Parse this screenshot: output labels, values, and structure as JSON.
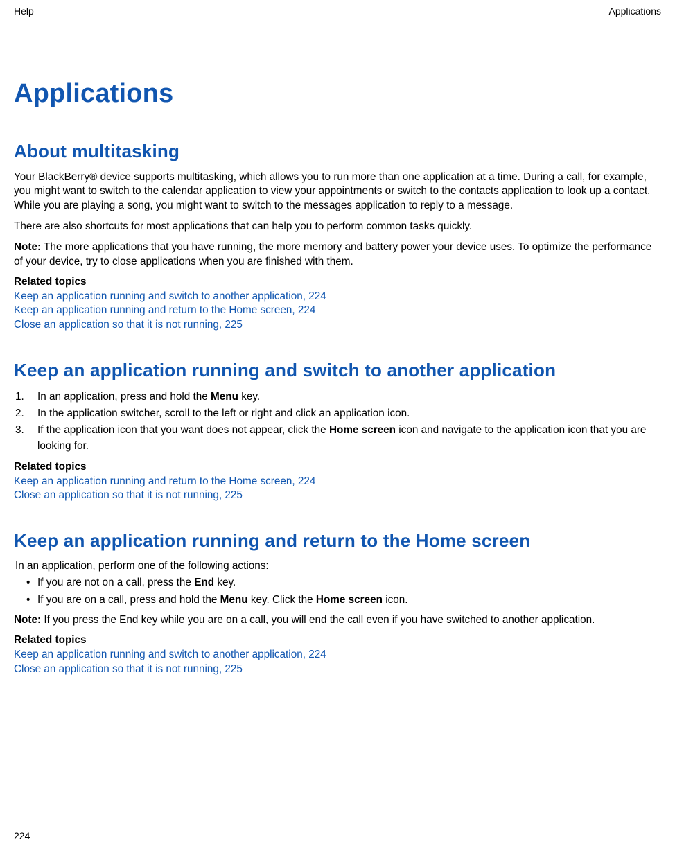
{
  "header": {
    "left": "Help",
    "right": "Applications"
  },
  "page_title": "Applications",
  "page_number": "224",
  "sections": {
    "about": {
      "heading": "About multitasking",
      "p1": "Your BlackBerry® device supports multitasking, which allows you to run more than one application at a time. During a call, for example, you might want to switch to the calendar application to view your appointments or switch to the contacts application to look up a contact. While you are playing a song, you might want to switch to the messages application to reply to a message.",
      "p2": "There are also shortcuts for most applications that can help you to perform common tasks quickly.",
      "note_label": "Note:",
      "note_body": "  The more applications that you have running, the more memory and battery power your device uses. To optimize the performance of your device, try to close applications when you are finished with them.",
      "related_label": "Related topics",
      "links": [
        "Keep an application running and switch to another application, 224",
        "Keep an application running and return to the Home screen, 224",
        "Close an application so that it is not running, 225"
      ]
    },
    "switch": {
      "heading": "Keep an application running and switch to another application",
      "s1a": "In an application, press and hold the ",
      "s1b": "Menu",
      "s1c": " key.",
      "s2": "In the application switcher, scroll to the left or right and click an application icon.",
      "s3a": "If the application icon that you want does not appear, click the ",
      "s3b": "Home screen",
      "s3c": " icon and navigate to the application icon that you are looking for.",
      "related_label": "Related topics",
      "links": [
        "Keep an application running and return to the Home screen, 224",
        "Close an application so that it is not running, 225"
      ]
    },
    "home": {
      "heading": "Keep an application running and return to the Home screen",
      "intro": "In an application, perform one of the following actions:",
      "b1a": "If you are not on a call, press the ",
      "b1b": "End",
      "b1c": " key.",
      "b2a": "If you are on a call, press and hold the ",
      "b2b": "Menu",
      "b2c": " key. Click the ",
      "b2d": "Home screen",
      "b2e": " icon.",
      "note_label": "Note:",
      "note_body": "  If you press the End key while you are on a call, you will end the call even if you have switched to another application.",
      "related_label": "Related topics",
      "links": [
        "Keep an application running and switch to another application, 224",
        "Close an application so that it is not running, 225"
      ]
    }
  }
}
